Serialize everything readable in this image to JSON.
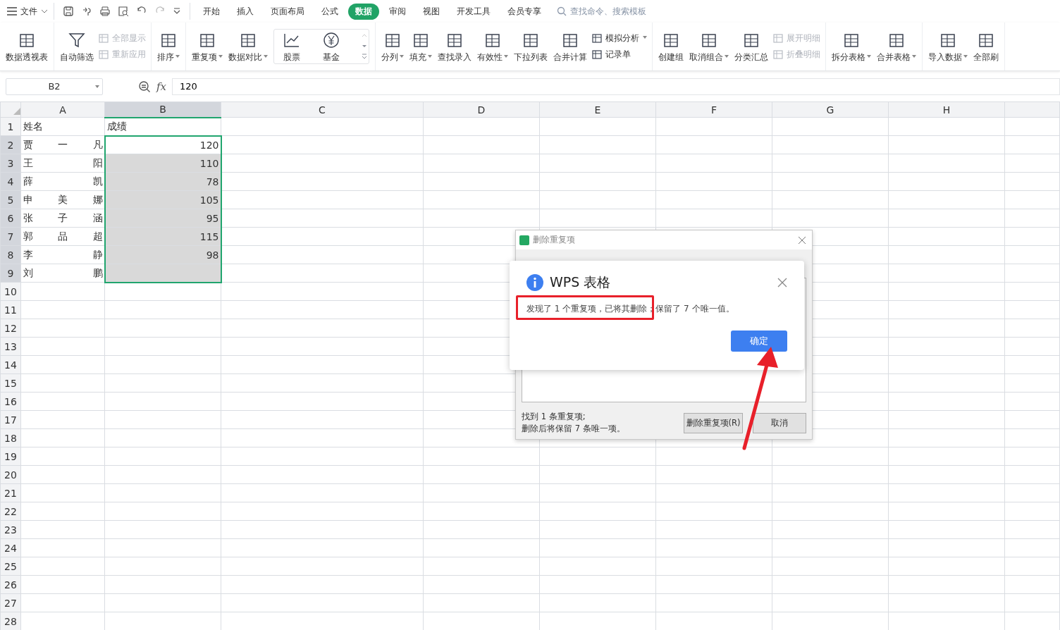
{
  "file_menu": {
    "label": "文件"
  },
  "tabs": [
    {
      "label": "开始",
      "selected": false
    },
    {
      "label": "插入",
      "selected": false
    },
    {
      "label": "页面布局",
      "selected": false
    },
    {
      "label": "公式",
      "selected": false
    },
    {
      "label": "数据",
      "selected": true
    },
    {
      "label": "审阅",
      "selected": false
    },
    {
      "label": "视图",
      "selected": false
    },
    {
      "label": "开发工具",
      "selected": false
    },
    {
      "label": "会员专享",
      "selected": false
    }
  ],
  "search": {
    "placeholder": "查找命令、搜索模板"
  },
  "ribbon": [
    [
      {
        "kind": "large",
        "label": "数据透视表",
        "dropdown": false
      }
    ],
    [
      {
        "kind": "large",
        "label": "自动筛选",
        "dropdown": false
      },
      {
        "kind": "stack",
        "items": [
          {
            "label": "全部显示",
            "disabled": true,
            "dropdown": false
          },
          {
            "label": "重新应用",
            "disabled": true,
            "dropdown": false
          }
        ]
      }
    ],
    [
      {
        "kind": "large",
        "label": "排序",
        "dropdown": true
      }
    ],
    [
      {
        "kind": "large",
        "label": "重复项",
        "dropdown": true
      },
      {
        "kind": "large",
        "label": "数据对比",
        "dropdown": true
      },
      {
        "kind": "gallery",
        "items": [
          {
            "label": "股票"
          },
          {
            "label": "基金"
          }
        ]
      }
    ],
    [
      {
        "kind": "large",
        "label": "分列",
        "dropdown": true
      },
      {
        "kind": "large",
        "label": "填充",
        "dropdown": true
      },
      {
        "kind": "large",
        "label": "查找录入",
        "dropdown": false
      },
      {
        "kind": "large",
        "label": "有效性",
        "dropdown": true
      },
      {
        "kind": "large",
        "label": "下拉列表",
        "dropdown": false
      },
      {
        "kind": "large",
        "label": "合并计算",
        "dropdown": false
      },
      {
        "kind": "stack",
        "items": [
          {
            "label": "模拟分析",
            "disabled": false,
            "dropdown": true
          },
          {
            "label": "记录单",
            "disabled": false,
            "dropdown": false
          }
        ]
      }
    ],
    [
      {
        "kind": "large",
        "label": "创建组",
        "dropdown": false
      },
      {
        "kind": "large",
        "label": "取消组合",
        "dropdown": true
      },
      {
        "kind": "large",
        "label": "分类汇总",
        "dropdown": false
      },
      {
        "kind": "stack",
        "items": [
          {
            "label": "展开明细",
            "disabled": true,
            "dropdown": false
          },
          {
            "label": "折叠明细",
            "disabled": true,
            "dropdown": false
          }
        ]
      }
    ],
    [
      {
        "kind": "large",
        "label": "拆分表格",
        "dropdown": true
      },
      {
        "kind": "large",
        "label": "合并表格",
        "dropdown": true
      }
    ],
    [
      {
        "kind": "large",
        "label": "导入数据",
        "dropdown": true
      },
      {
        "kind": "large",
        "label": "全部刷",
        "dropdown": false
      }
    ]
  ],
  "name_box": "B2",
  "function_label": "fx",
  "formula": "120",
  "columns": [
    {
      "label": "A",
      "selected": false
    },
    {
      "label": "B",
      "selected": true
    },
    {
      "label": "C",
      "selected": false
    },
    {
      "label": "D",
      "selected": false
    },
    {
      "label": "E",
      "selected": false
    },
    {
      "label": "F",
      "selected": false
    },
    {
      "label": "G",
      "selected": false
    },
    {
      "label": "H",
      "selected": false
    }
  ],
  "rows": [
    {
      "header": "1",
      "selected": false,
      "cells": [
        "姓名",
        "成绩"
      ]
    },
    {
      "header": "2",
      "selected": true,
      "cells": [
        "贾一凡",
        "120"
      ]
    },
    {
      "header": "3",
      "selected": true,
      "cells": [
        "王阳",
        "110"
      ]
    },
    {
      "header": "4",
      "selected": true,
      "cells": [
        "薛凯",
        "78"
      ]
    },
    {
      "header": "5",
      "selected": true,
      "cells": [
        "申美娜",
        "105"
      ]
    },
    {
      "header": "6",
      "selected": true,
      "cells": [
        "张子涵",
        "95"
      ]
    },
    {
      "header": "7",
      "selected": true,
      "cells": [
        "郭品超",
        "115"
      ]
    },
    {
      "header": "8",
      "selected": true,
      "cells": [
        "李静",
        "98"
      ]
    },
    {
      "header": "9",
      "selected": true,
      "cells": [
        "刘鹏",
        ""
      ]
    },
    {
      "header": "10",
      "selected": false,
      "cells": []
    },
    {
      "header": "11",
      "selected": false,
      "cells": []
    },
    {
      "header": "12",
      "selected": false,
      "cells": []
    },
    {
      "header": "13",
      "selected": false,
      "cells": []
    },
    {
      "header": "14",
      "selected": false,
      "cells": []
    },
    {
      "header": "15",
      "selected": false,
      "cells": []
    },
    {
      "header": "16",
      "selected": false,
      "cells": []
    },
    {
      "header": "17",
      "selected": false,
      "cells": []
    },
    {
      "header": "18",
      "selected": false,
      "cells": []
    },
    {
      "header": "19",
      "selected": false,
      "cells": []
    },
    {
      "header": "20",
      "selected": false,
      "cells": []
    },
    {
      "header": "21",
      "selected": false,
      "cells": []
    },
    {
      "header": "22",
      "selected": false,
      "cells": []
    },
    {
      "header": "23",
      "selected": false,
      "cells": []
    },
    {
      "header": "24",
      "selected": false,
      "cells": []
    },
    {
      "header": "25",
      "selected": false,
      "cells": []
    },
    {
      "header": "26",
      "selected": false,
      "cells": []
    },
    {
      "header": "27",
      "selected": false,
      "cells": []
    },
    {
      "header": "28",
      "selected": false,
      "cells": []
    }
  ],
  "remove_dialog": {
    "title": "删除重复项",
    "found_lines": [
      "找到 1 条重复项;",
      "删除后将保留 7 条唯一项。"
    ],
    "buttons": [
      "删除重复项(R)",
      "取消"
    ]
  },
  "message_dialog": {
    "title": "WPS 表格",
    "text": "发现了 1 个重复项，已将其删除；保留了 7 个唯一值。",
    "button": "确定"
  }
}
